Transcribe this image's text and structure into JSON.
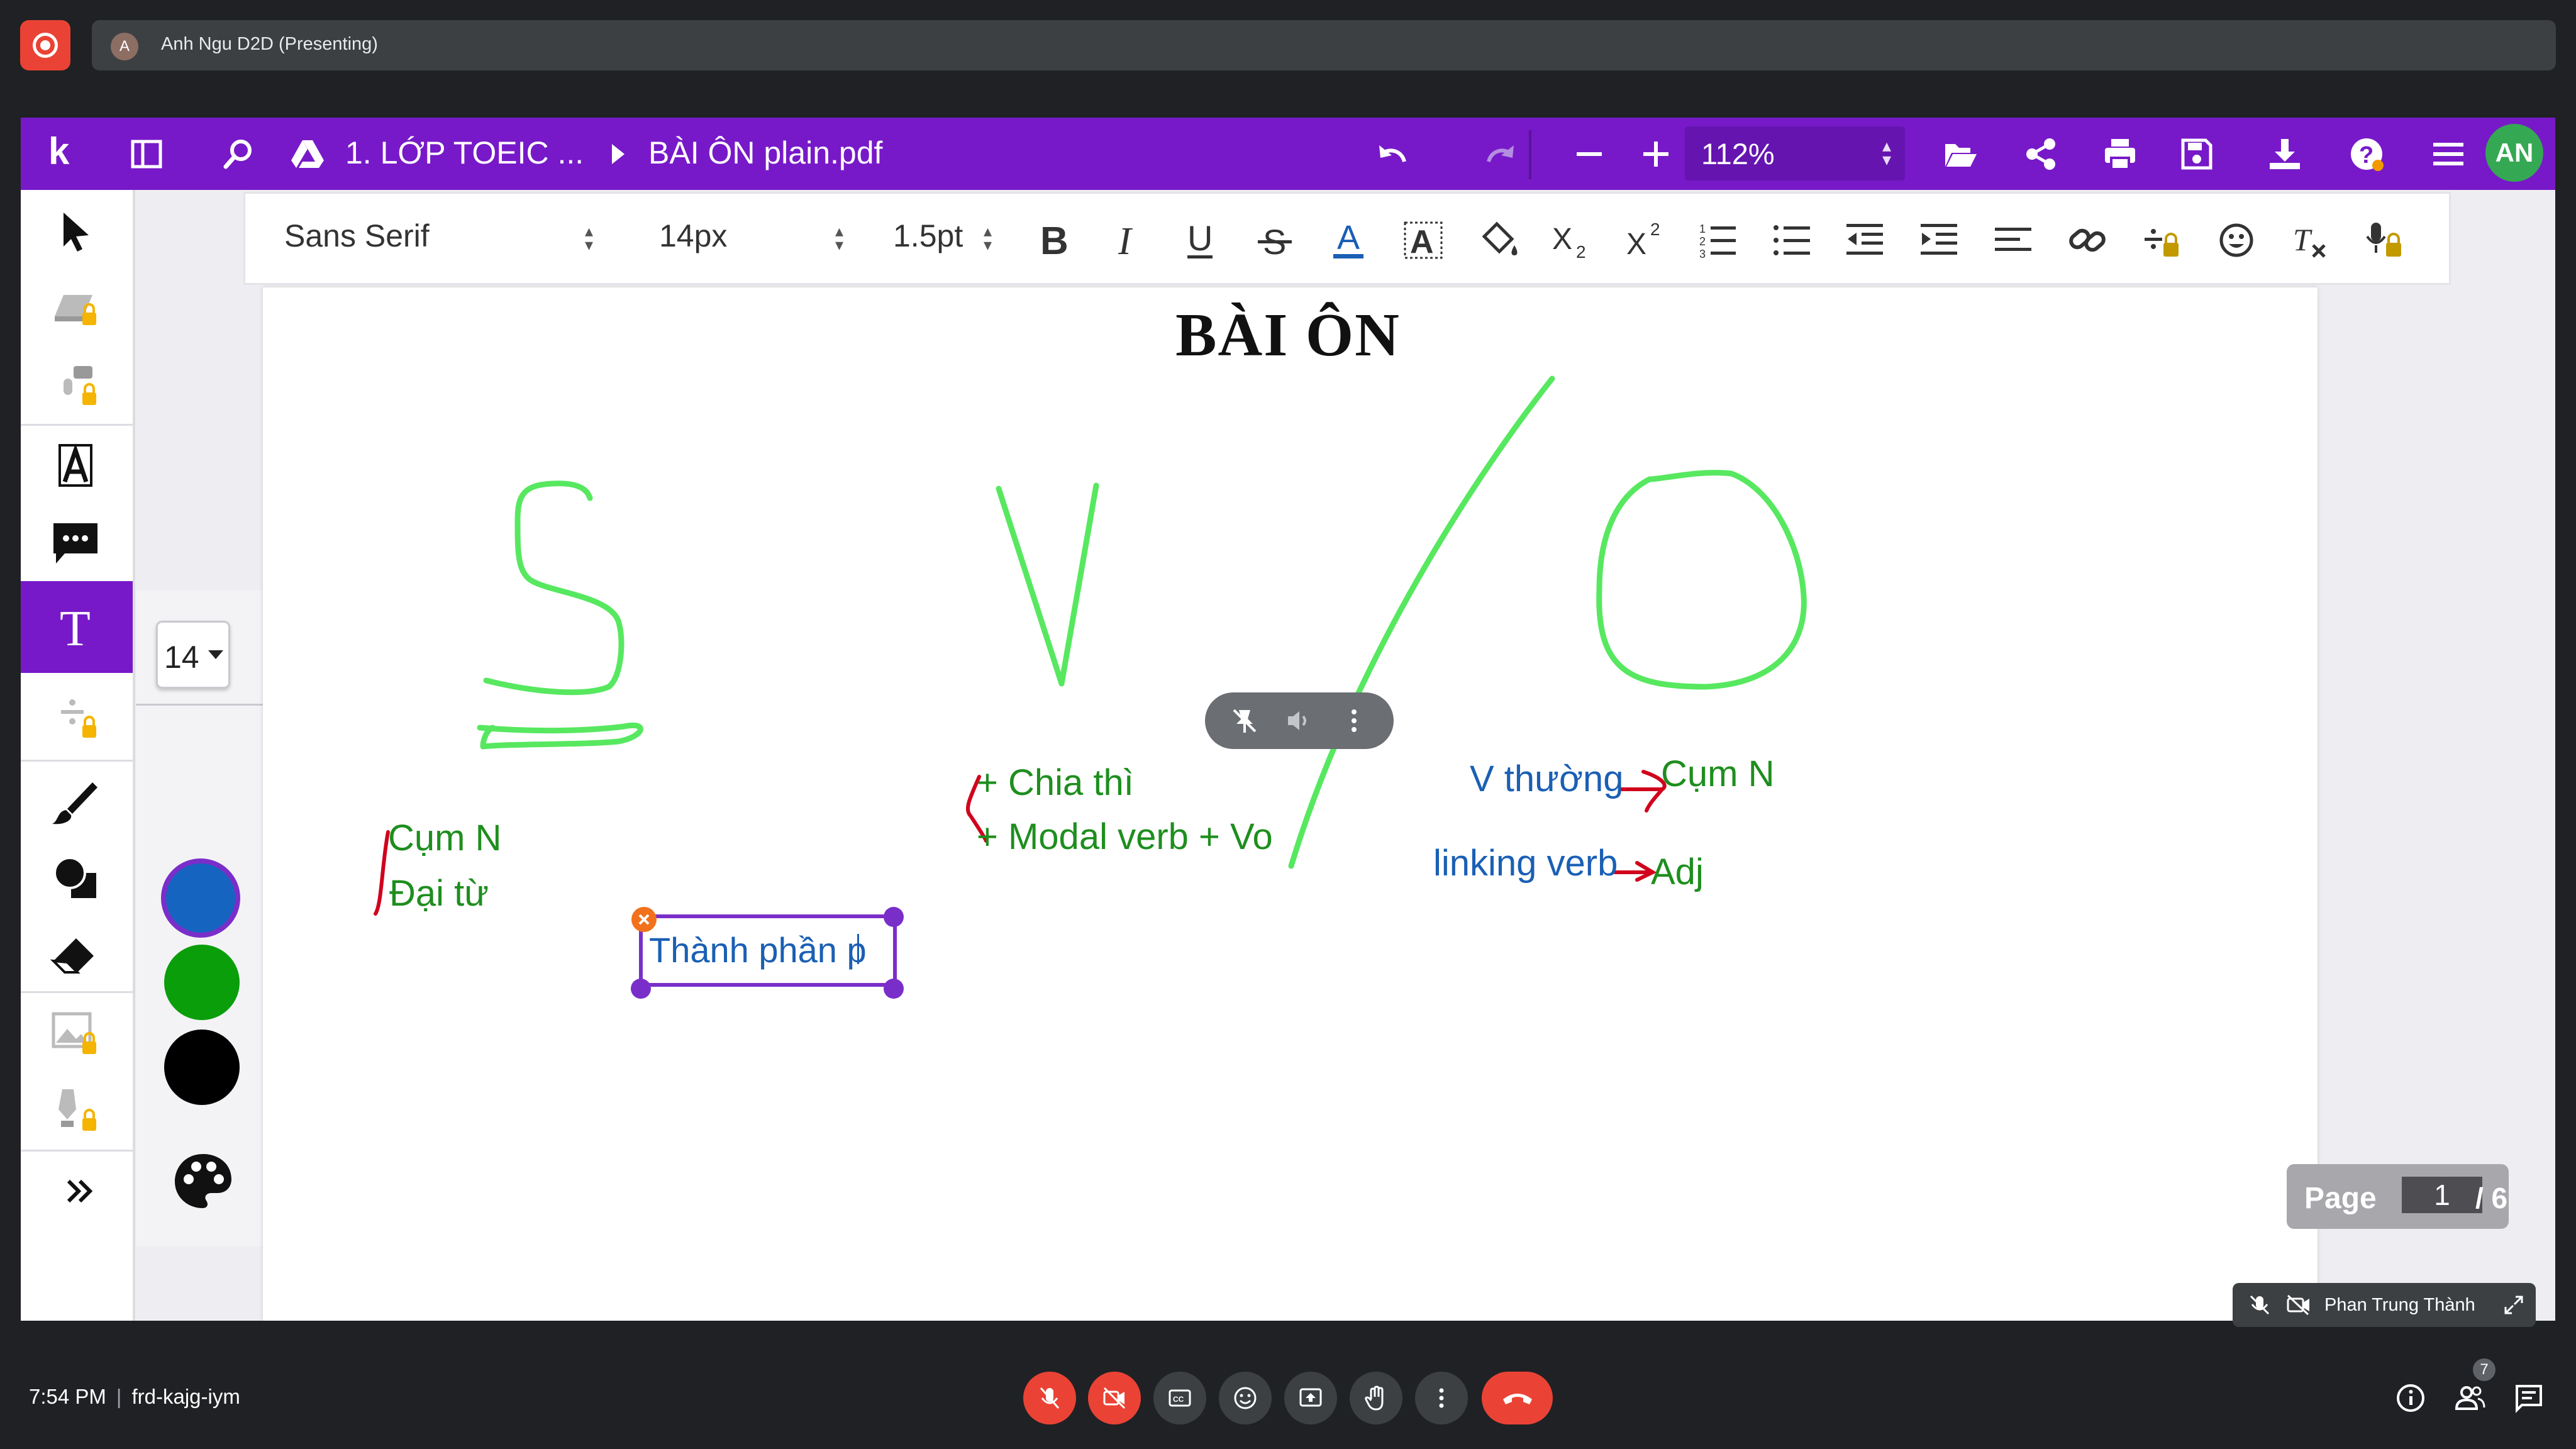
{
  "meet": {
    "presenting_avatar": "A",
    "presenting_text": "Anh Ngu D2D (Presenting)",
    "time": "7:54 PM",
    "separator": "|",
    "meeting_code": "frd-kajg-iym",
    "people_count": "7",
    "tile_name": "Phan Trung Thành",
    "brand_red": "#ea4335"
  },
  "kami": {
    "breadcrumb_folder": "1. LỚP TOEIC ...",
    "file_name": "BÀI ÔN plain.pdf",
    "zoom": "112%",
    "user_initials": "AN",
    "accent": "#7719c8",
    "font_family": "Sans Serif",
    "font_size": "14px",
    "line_width": "1.5pt",
    "text_size_option": "14",
    "swatches": [
      "#1565c0",
      "#0a9e0a",
      "#000000"
    ]
  },
  "document": {
    "title": "BÀI ÔN",
    "notes": {
      "s_item1": "Cụm N",
      "s_item2": "Đại từ",
      "v_item1": "+ Chia thì",
      "v_item2": "+ Modal verb + Vo",
      "o_line1_left": "V thường",
      "o_line1_right": "Cụm N",
      "o_line2_left": "linking verb",
      "o_line2_right": "Adj"
    },
    "editing_text": "Thành phần p"
  },
  "pager": {
    "label": "Page",
    "current": "1",
    "total": "/ 6"
  }
}
